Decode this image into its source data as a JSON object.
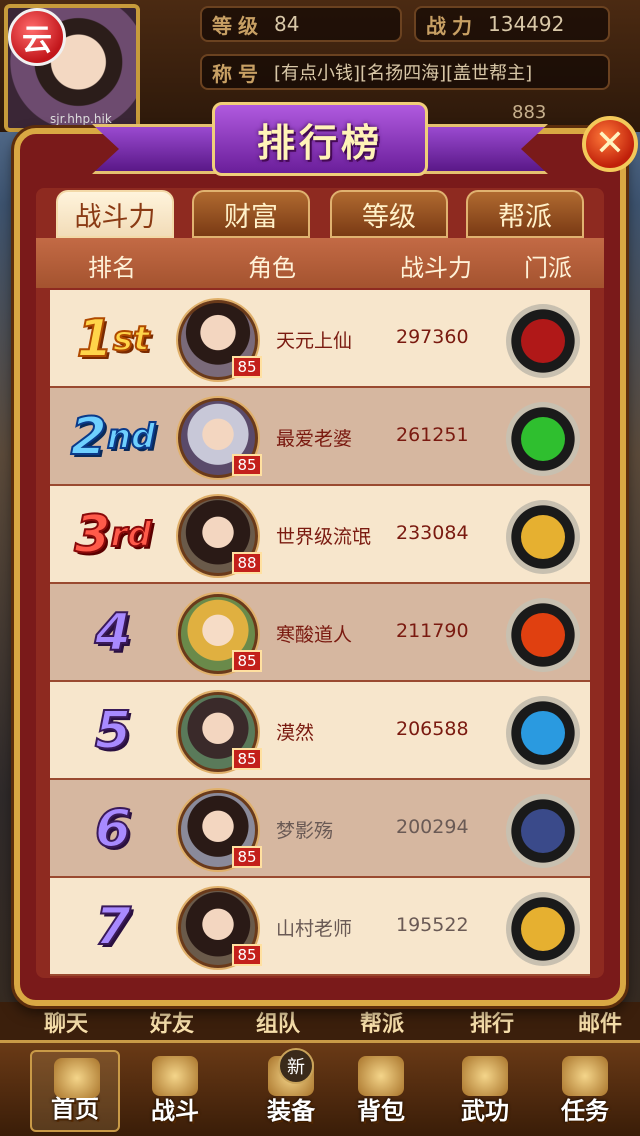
{
  "header": {
    "app_badge": "云",
    "player_name": "sjr.hhp.hik",
    "level_label": "等级",
    "level_value": "84",
    "power_label": "战力",
    "power_value": "134492",
    "title_label": "称号",
    "title_value": "[有点小钱][名扬四海][盖世帮主]",
    "extra_value": "883"
  },
  "dialog": {
    "title": "排行榜",
    "close": "✕",
    "tabs": [
      {
        "label": "战斗力"
      },
      {
        "label": "财富"
      },
      {
        "label": "等级"
      },
      {
        "label": "帮派"
      }
    ],
    "columns": {
      "rank": "排名",
      "role": "角色",
      "power": "战斗力",
      "sect": "门派"
    },
    "rows": [
      {
        "rank": "1st",
        "level": "85",
        "name": "天元上仙",
        "power": "297360",
        "sect_icon": "red-sect-icon",
        "sect_color": "#b01818"
      },
      {
        "rank": "2nd",
        "level": "85",
        "name": "最爱老婆",
        "power": "261251",
        "sect_icon": "green-sect-icon",
        "sect_color": "#2fbf2f"
      },
      {
        "rank": "3rd",
        "level": "88",
        "name": "世界级流氓",
        "power": "233084",
        "sect_icon": "gold-gourd-sect-icon",
        "sect_color": "#e6b030"
      },
      {
        "rank": "4",
        "level": "85",
        "name": "寒酸道人",
        "power": "211790",
        "sect_icon": "fire-sect-icon",
        "sect_color": "#e04010"
      },
      {
        "rank": "5",
        "level": "85",
        "name": "漠然",
        "power": "206588",
        "sect_icon": "water-sect-icon",
        "sect_color": "#2a9ae0"
      },
      {
        "rank": "6",
        "level": "85",
        "name": "梦影殇",
        "power": "200294",
        "sect_icon": "mask-sect-icon",
        "sect_color": "#3a4a8a"
      },
      {
        "rank": "7",
        "level": "85",
        "name": "山村老师",
        "power": "195522",
        "sect_icon": "gold-gourd-sect-icon",
        "sect_color": "#e6b030"
      }
    ]
  },
  "chat_shortcuts": [
    "聊天",
    "好友",
    "组队",
    "帮派",
    "排行",
    "邮件"
  ],
  "bottom_nav": [
    {
      "label": "首页",
      "icon": "home-icon"
    },
    {
      "label": "战斗",
      "icon": "battle-icon"
    },
    {
      "label": "装备",
      "icon": "equipment-icon"
    },
    {
      "label": "背包",
      "icon": "bag-icon"
    },
    {
      "label": "武功",
      "icon": "martial-icon"
    },
    {
      "label": "任务",
      "icon": "task-icon"
    }
  ],
  "new_badge": "新"
}
